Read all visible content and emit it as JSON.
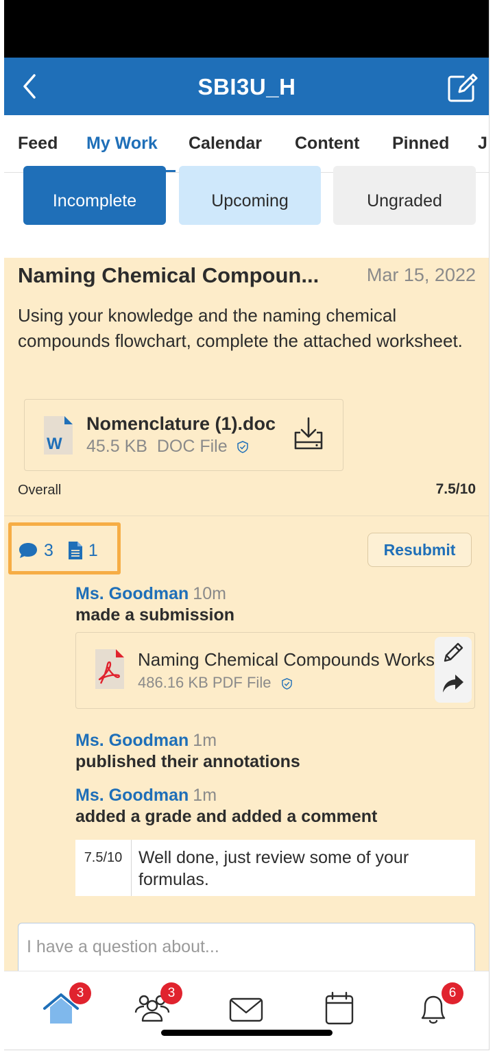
{
  "header": {
    "title": "SBI3U_H"
  },
  "tabs": [
    {
      "label": "Feed",
      "active": false
    },
    {
      "label": "My Work",
      "active": true
    },
    {
      "label": "Calendar",
      "active": false
    },
    {
      "label": "Content",
      "active": false
    },
    {
      "label": "Pinned",
      "active": false
    },
    {
      "label": "J",
      "active": false
    }
  ],
  "summary": {
    "incomplete": "Incomplete",
    "upcoming": "Upcoming",
    "ungraded": "Ungraded"
  },
  "assignment": {
    "title": "Naming Chemical Compoun...",
    "date": "Mar 15, 2022",
    "description": "Using your knowledge and the naming chemical compounds flowchart, complete the attached worksheet.",
    "attachment": {
      "name": "Nomenclature (1).doc",
      "size": "45.5 KB",
      "type": "DOC File"
    },
    "overall_label": "Overall",
    "overall_grade": "7.5/10"
  },
  "activity": {
    "comment_count": "3",
    "file_count": "1",
    "resubmit_label": "Resubmit",
    "entries": [
      {
        "author": "Ms. Goodman",
        "time": "10m",
        "action": "made a submission"
      },
      {
        "author": "Ms. Goodman",
        "time": "1m",
        "action": "published their annotations"
      },
      {
        "author": "Ms. Goodman",
        "time": "1m",
        "action": "added a grade and added a comment"
      }
    ],
    "submission": {
      "name": "Naming Chemical Compounds Worksheet",
      "size": "486.16 KB",
      "type": "PDF File"
    },
    "grade": {
      "value": "7.5/10",
      "comment": "Well done, just review some of your formulas."
    }
  },
  "question": {
    "placeholder": "I have a question about..."
  },
  "tabbar": {
    "home_badge": "3",
    "people_badge": "3",
    "notifications_badge": "6"
  },
  "colors": {
    "primary": "#1f6fb8",
    "card_bg": "#fdecc9",
    "highlight": "#f6ad45",
    "badge": "#e0232e"
  }
}
